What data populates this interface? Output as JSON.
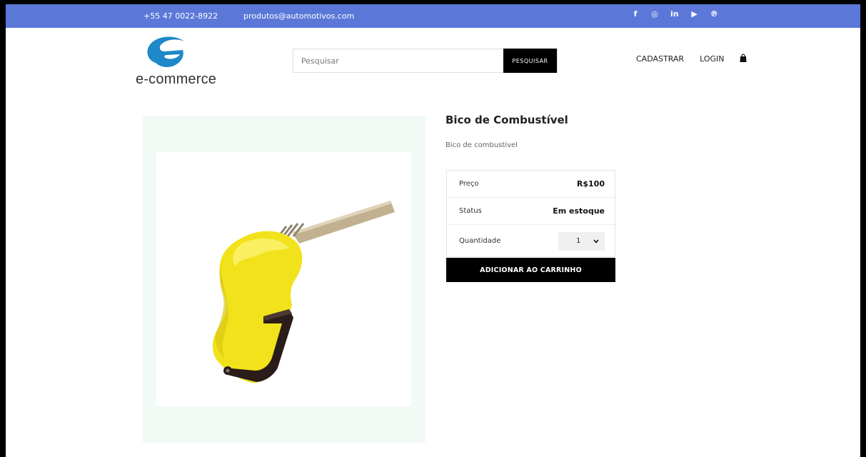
{
  "topbar": {
    "phone": "+55 47 0022-8922",
    "email": "produtos@automotivos.com",
    "social": [
      {
        "icon": "facebook-icon",
        "glyph": "f"
      },
      {
        "icon": "instagram-icon",
        "glyph": "◎"
      },
      {
        "icon": "linkedin-icon",
        "glyph": "in"
      },
      {
        "icon": "youtube-icon",
        "glyph": "▶"
      },
      {
        "icon": "pinterest-icon",
        "glyph": "℗"
      }
    ]
  },
  "logo": {
    "text": "e-commerce",
    "color": "#1e88c8"
  },
  "search": {
    "placeholder": "Pesquisar",
    "button_label": "PESQUISAR"
  },
  "nav": {
    "register": "CADASTRAR",
    "login": "LOGIN",
    "cart_icon": "shopping-bag-icon"
  },
  "product": {
    "title": "Bico de Combustível",
    "description": "Bico de combustivel",
    "price_label": "Preço",
    "price_value": "R$100",
    "status_label": "Status",
    "status_value": "Em estoque",
    "quantity_label": "Quantidade",
    "quantity_value": "1",
    "add_button": "ADICIONAR AO CARRINHO",
    "image_colors": {
      "body": "#f1e21b",
      "lever": "#2a1c18",
      "spout": "#b8a68a"
    }
  },
  "colors": {
    "topbar": "#5b78d8",
    "button": "#000000",
    "image_bg": "#f2faf6"
  }
}
